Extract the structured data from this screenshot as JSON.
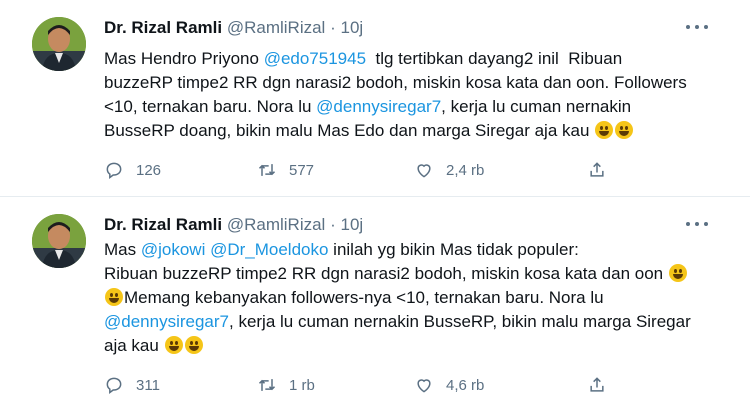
{
  "tweets": [
    {
      "name": "Dr. Rizal Ramli",
      "handle": "@RamliRizal",
      "dot": "·",
      "time": "10j",
      "lines": [
        {
          "parts": [
            {
              "t": "Mas Hendro Priyono "
            },
            {
              "m": "@edo751945"
            },
            {
              "t": "  tlg tertibkan dayang2 inil  Ribuan"
            }
          ]
        },
        {
          "parts": [
            {
              "t": "buzzeRP timpe2 RR dgn narasi2 bodoh, miskin kosa kata dan oon. Followers"
            }
          ]
        },
        {
          "parts": [
            {
              "t": "<10, ternakan baru. Nora lu "
            },
            {
              "m": "@dennysiregar7"
            },
            {
              "t": ", kerja lu cuman nernakin"
            }
          ]
        },
        {
          "parts": [
            {
              "t": "BusseRP doang, bikin malu Mas Edo dan marga Siregar aja kau "
            },
            {
              "e": "grinning-face"
            },
            {
              "e": "grinning-face"
            }
          ]
        }
      ],
      "replies": "126",
      "retweets": "577",
      "likes": "2,4 rb"
    },
    {
      "name": "Dr. Rizal Ramli",
      "handle": "@RamliRizal",
      "dot": "·",
      "time": "10j",
      "lines": [
        {
          "parts": [
            {
              "t": "Mas "
            },
            {
              "m": "@jokowi"
            },
            {
              "t": " "
            },
            {
              "m": "@Dr_Moeldoko"
            },
            {
              "t": " inilah yg bikin Mas tidak populer:"
            }
          ]
        },
        {
          "parts": [
            {
              "t": "Ribuan buzzeRP timpe2 RR dgn narasi2 bodoh, miskin kosa kata dan oon "
            },
            {
              "e": "grinning-face"
            }
          ]
        },
        {
          "parts": [
            {
              "e": "grinning-face"
            },
            {
              "t": "Memang kebanyakan followers-nya <10, ternakan baru. Nora lu"
            }
          ]
        },
        {
          "parts": [
            {
              "m": "@dennysiregar7"
            },
            {
              "t": ", kerja lu cuman nernakin BusseRP, bikin malu marga Siregar"
            }
          ]
        },
        {
          "parts": [
            {
              "t": "aja kau "
            },
            {
              "e": "grinning-face"
            },
            {
              "e": "grinning-face"
            }
          ]
        }
      ],
      "replies": "311",
      "retweets": "1 rb",
      "likes": "4,6 rb"
    }
  ],
  "icons": {
    "reply": "reply-icon",
    "retweet": "retweet-icon",
    "like": "heart-icon",
    "share": "share-icon",
    "more": "more-options-icon"
  },
  "colors": {
    "mention": "#1b95e0",
    "secondary_text": "#5b7083",
    "divider": "#e6ecf0"
  }
}
